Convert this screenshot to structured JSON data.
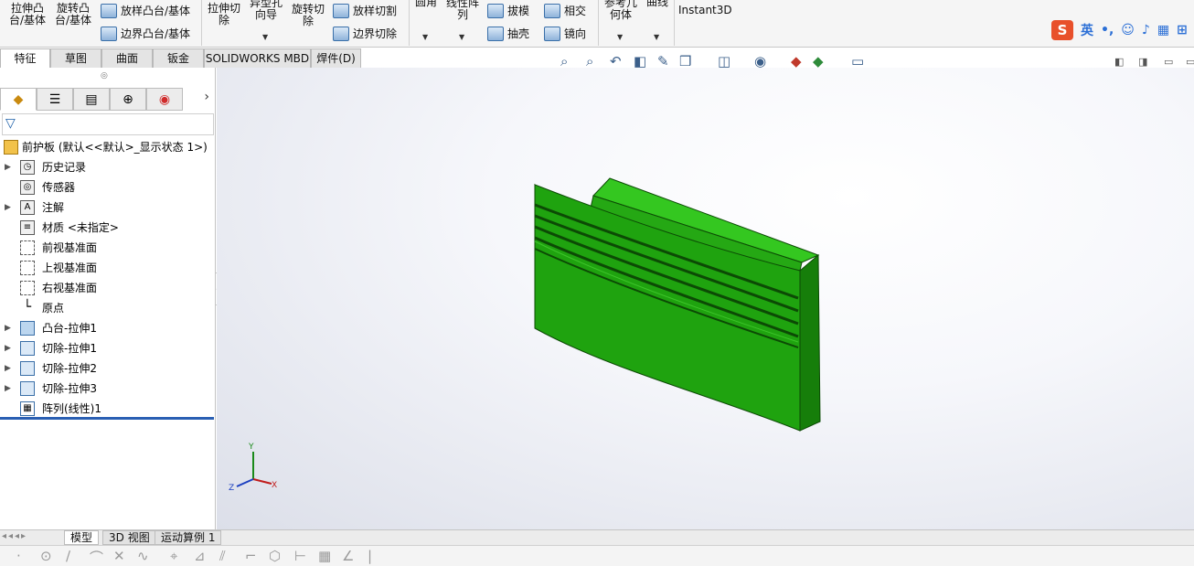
{
  "ribbon": {
    "extrude_boss_l1": "拉伸凸",
    "extrude_boss_l2": "台/基体",
    "revolve_boss_l1": "旋转凸",
    "revolve_boss_l2": "台/基体",
    "loft_boss": "放样凸台/基体",
    "boundary_boss": "边界凸台/基体",
    "extrude_cut_l1": "拉伸切",
    "extrude_cut_l2": "除",
    "hole_wizard_l1": "异型孔",
    "hole_wizard_l2": "向导",
    "revolve_cut_l1": "旋转切",
    "revolve_cut_l2": "除",
    "loft_cut": "放样切割",
    "boundary_cut": "边界切除",
    "fillet": "圆角",
    "linear_pattern_l1": "线性阵",
    "linear_pattern_l2": "列",
    "draft": "拔模",
    "shell": "抽壳",
    "intersect": "相交",
    "mirror": "镜向",
    "ref_geometry_l1": "参考几",
    "ref_geometry_l2": "何体",
    "curves": "曲线",
    "instant3d": "Instant3D"
  },
  "ime": {
    "logo": "S",
    "lang": "英",
    "punct": "•,"
  },
  "command_tabs": [
    "特征",
    "草图",
    "曲面",
    "钣金",
    "SOLIDWORKS MBD",
    "焊件(D)"
  ],
  "tree": {
    "root": "前护板  (默认<<默认>_显示状态 1>)",
    "items": [
      "历史记录",
      "传感器",
      "注解",
      "材质 <未指定>",
      "前视基准面",
      "上视基准面",
      "右视基准面",
      "原点",
      "凸台-拉伸1",
      "切除-拉伸1",
      "切除-拉伸2",
      "切除-拉伸3",
      "阵列(线性)1"
    ]
  },
  "triad": {
    "x": "X",
    "y": "Y",
    "z": "Z"
  },
  "bottom_tabs": [
    "模型",
    "3D 视图",
    "运动算例 1"
  ],
  "colors": {
    "part_green": "#1fa30f",
    "part_green_dark": "#127a08",
    "part_green_light": "#3dc42a",
    "selection_blue": "#2a5fb3"
  }
}
